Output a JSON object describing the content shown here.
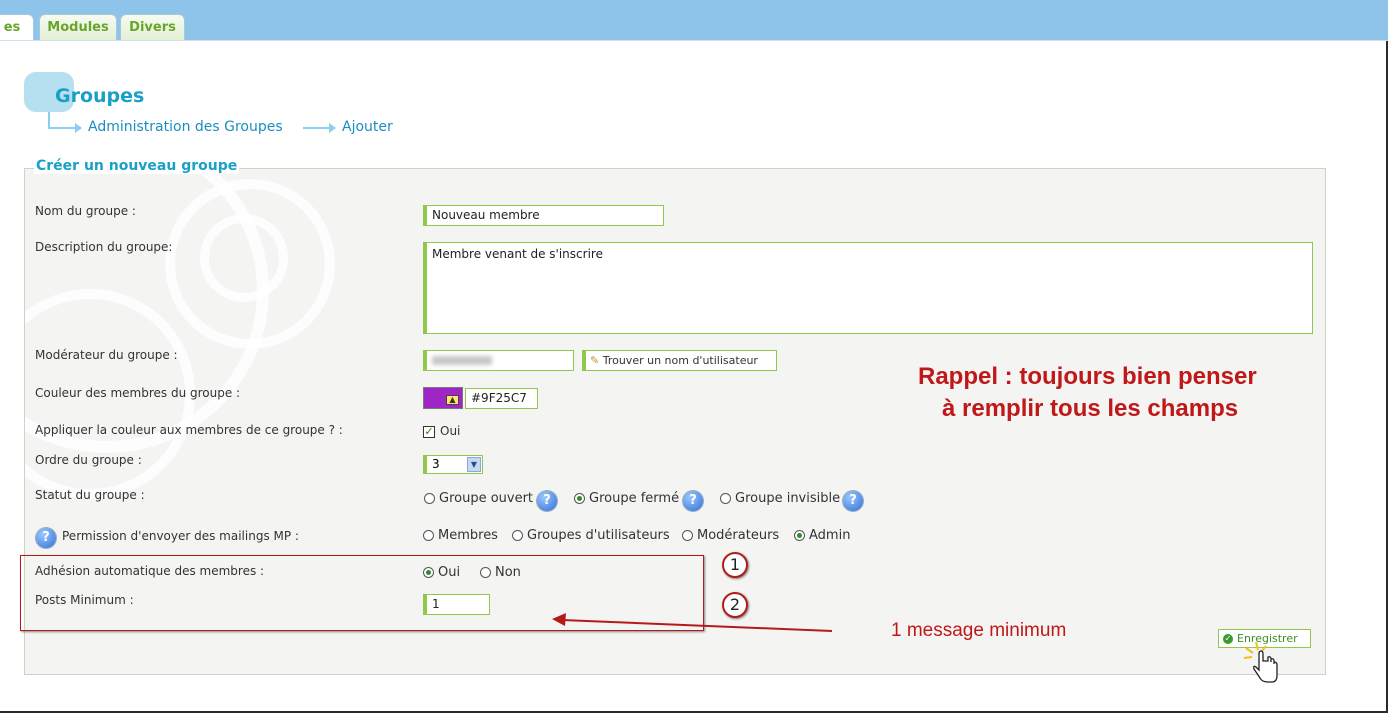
{
  "tabs": [
    {
      "label": "es",
      "active": true
    },
    {
      "label": "Modules",
      "active": false
    },
    {
      "label": "Divers",
      "active": false
    }
  ],
  "page": {
    "title": "Groupes",
    "breadcrumb": [
      "Administration des Groupes",
      "Ajouter"
    ]
  },
  "form": {
    "legend": "Créer un nouveau groupe",
    "name_label": "Nom du groupe :",
    "name_value": "Nouveau membre",
    "description_label": "Description du groupe:",
    "description_value": "Membre venant de s'inscrire",
    "moderator_label": "Modérateur du groupe :",
    "find_user_button": "Trouver un nom d'utilisateur",
    "color_label": "Couleur des membres du groupe :",
    "color_value": "#9F25C7",
    "apply_color_label": "Appliquer la couleur aux membres de ce groupe ? :",
    "apply_color_option": "Oui",
    "order_label": "Ordre du groupe :",
    "order_value": "3",
    "status_label": "Statut du groupe :",
    "status_options": [
      "Groupe ouvert",
      "Groupe fermé",
      "Groupe invisible"
    ],
    "status_selected": "Groupe fermé",
    "mailing_label": "Permission d'envoyer des mailings MP :",
    "mailing_options": [
      "Membres",
      "Groupes d'utilisateurs",
      "Modérateurs",
      "Admin"
    ],
    "mailing_selected": "Admin",
    "auto_join_label": "Adhésion automatique des membres :",
    "auto_join_options": [
      "Oui",
      "Non"
    ],
    "auto_join_selected": "Oui",
    "min_posts_label": "Posts Minimum :",
    "min_posts_value": "1",
    "save_button": "Enregistrer"
  },
  "annotations": {
    "reminder_line1": "Rappel : toujours bien penser",
    "reminder_line2": "à remplir tous les champs",
    "circle1": "1",
    "circle2": "2",
    "min_message": "1 message minimum"
  },
  "colors": {
    "accent": "#1aa0c8",
    "field_border": "#8fc84c",
    "annotation_red": "#c01818",
    "group_color": "#9F25C7"
  }
}
